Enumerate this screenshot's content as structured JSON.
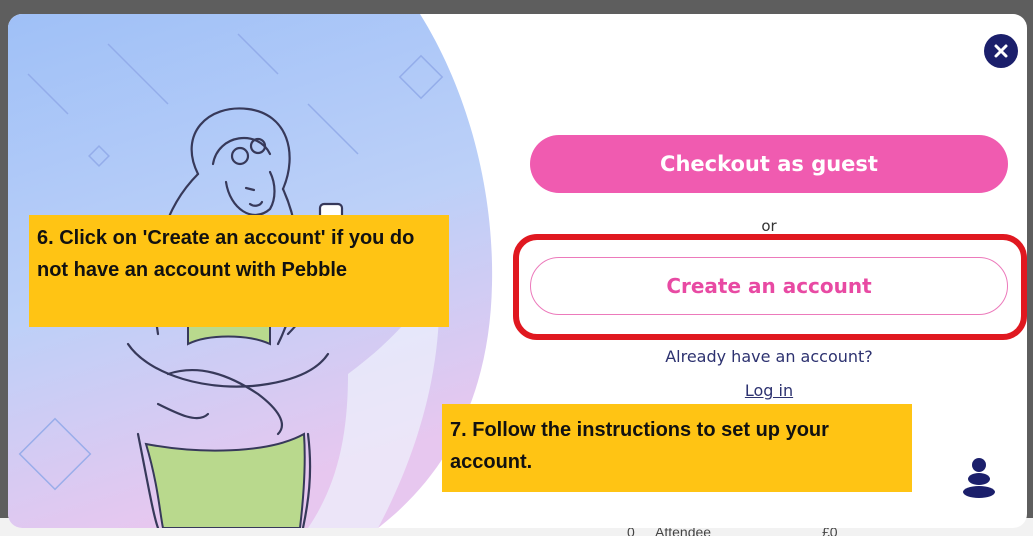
{
  "backdrop": {
    "row_number": "0",
    "row_label": "Attendee",
    "row_value": "£0"
  },
  "modal": {
    "close_icon": "close-icon",
    "checkout_guest_label": "Checkout as guest",
    "or_label": "or",
    "create_account_label": "Create an account",
    "already_have_account_label": "Already have an account?",
    "login_label": "Log in",
    "logo_icon": "pebble-logo-icon"
  },
  "annotations": {
    "step6": "6. Click on 'Create an account' if you do not have an account with Pebble",
    "step7": "7. Follow the instructions to set up your account."
  },
  "colors": {
    "primary_pink": "#f05bb0",
    "navy": "#1b1f6b",
    "highlight_red": "#e01820",
    "callout_yellow": "#ffc414"
  }
}
